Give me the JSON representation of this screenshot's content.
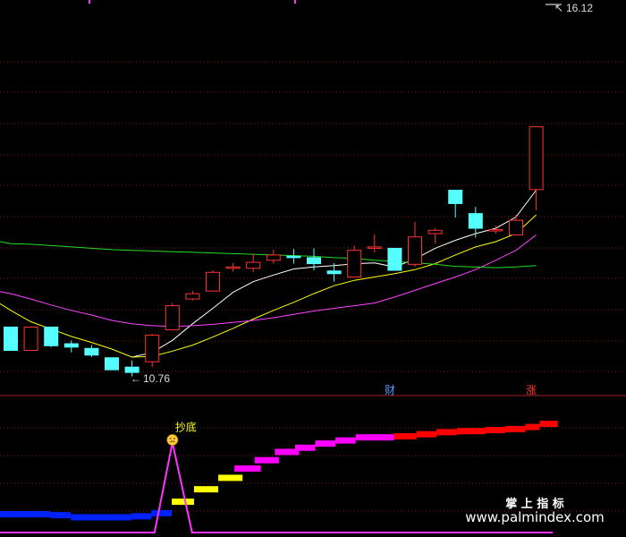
{
  "chart_data": [
    {
      "type": "candlestick",
      "panel": "price",
      "title": "",
      "ylim": [
        10.3,
        16.2
      ],
      "grid": true,
      "annotations": {
        "high_label": "16.12",
        "low_label": "10.76",
        "badge_cai": "财",
        "badge_zhang": "涨"
      },
      "candles": [
        {
          "o": 11.3,
          "c": 10.95,
          "h": 11.3,
          "l": 10.95
        },
        {
          "o": 10.95,
          "c": 11.3,
          "h": 11.3,
          "l": 10.95
        },
        {
          "o": 11.3,
          "c": 11.02,
          "h": 11.3,
          "l": 11.0
        },
        {
          "o": 11.05,
          "c": 11.0,
          "h": 11.1,
          "l": 10.92
        },
        {
          "o": 10.98,
          "c": 10.88,
          "h": 11.03,
          "l": 10.85
        },
        {
          "o": 10.84,
          "c": 10.66,
          "h": 10.84,
          "l": 10.66
        },
        {
          "o": 10.7,
          "c": 10.62,
          "h": 10.8,
          "l": 10.56
        },
        {
          "o": 10.78,
          "c": 11.18,
          "h": 11.2,
          "l": 10.7
        },
        {
          "o": 11.26,
          "c": 11.62,
          "h": 11.66,
          "l": 11.26
        },
        {
          "o": 11.72,
          "c": 11.8,
          "h": 11.84,
          "l": 11.7
        },
        {
          "o": 11.84,
          "c": 12.12,
          "h": 12.15,
          "l": 11.84
        },
        {
          "o": 12.18,
          "c": 12.2,
          "h": 12.26,
          "l": 12.13
        },
        {
          "o": 12.18,
          "c": 12.27,
          "h": 12.4,
          "l": 12.12
        },
        {
          "o": 12.3,
          "c": 12.38,
          "h": 12.46,
          "l": 12.25
        },
        {
          "o": 12.36,
          "c": 12.35,
          "h": 12.47,
          "l": 12.25
        },
        {
          "o": 12.34,
          "c": 12.25,
          "h": 12.48,
          "l": 12.15
        },
        {
          "o": 12.14,
          "c": 12.1,
          "h": 12.26,
          "l": 11.98
        },
        {
          "o": 12.05,
          "c": 12.45,
          "h": 12.52,
          "l": 12.05
        },
        {
          "o": 12.48,
          "c": 12.5,
          "h": 12.69,
          "l": 12.42
        },
        {
          "o": 12.48,
          "c": 12.15,
          "h": 12.48,
          "l": 12.15
        },
        {
          "o": 12.24,
          "c": 12.65,
          "h": 12.88,
          "l": 12.2
        },
        {
          "o": 12.7,
          "c": 12.75,
          "h": 12.78,
          "l": 12.55
        },
        {
          "o": 13.35,
          "c": 13.15,
          "h": 13.35,
          "l": 12.94
        },
        {
          "o": 13.0,
          "c": 12.78,
          "h": 13.1,
          "l": 12.64
        },
        {
          "o": 12.75,
          "c": 12.76,
          "h": 12.82,
          "l": 12.7
        },
        {
          "o": 12.68,
          "c": 12.9,
          "h": 12.98,
          "l": 12.68
        },
        {
          "o": 13.36,
          "c": 14.3,
          "h": 14.3,
          "l": 13.05
        }
      ],
      "series": [
        {
          "color": "#FFFFFF",
          "values": [
            null,
            null,
            null,
            null,
            null,
            null,
            10.85,
            10.92,
            11.1,
            11.35,
            11.58,
            11.82,
            11.98,
            12.08,
            12.17,
            12.2,
            12.22,
            12.25,
            12.26,
            12.2,
            12.32,
            12.48,
            12.6,
            12.7,
            12.78,
            12.95,
            13.35
          ]
        },
        {
          "color": "#FFFF00",
          "values": [
            11.55,
            11.38,
            11.27,
            11.16,
            11.07,
            10.97,
            10.85,
            10.86,
            10.94,
            11.03,
            11.15,
            11.28,
            11.42,
            11.55,
            11.67,
            11.8,
            11.92,
            12.0,
            12.05,
            12.1,
            12.16,
            12.25,
            12.38,
            12.5,
            12.58,
            12.7,
            12.98
          ]
        },
        {
          "color": "#FF44FF",
          "values": [
            11.8,
            11.72,
            11.63,
            11.55,
            11.48,
            11.4,
            11.35,
            11.32,
            11.31,
            11.32,
            11.34,
            11.37,
            11.4,
            11.44,
            11.49,
            11.54,
            11.58,
            11.62,
            11.66,
            11.75,
            11.85,
            11.95,
            12.05,
            12.16,
            12.3,
            12.45,
            12.68
          ]
        },
        {
          "color": "#22DD22",
          "values": [
            12.55,
            12.54,
            12.52,
            12.5,
            12.48,
            12.46,
            12.45,
            12.44,
            12.43,
            12.42,
            12.41,
            12.4,
            12.39,
            12.38,
            12.37,
            12.36,
            12.34,
            12.33,
            12.3,
            12.28,
            12.26,
            12.24,
            12.21,
            12.2,
            12.19,
            12.2,
            12.22
          ]
        }
      ]
    },
    {
      "type": "step",
      "panel": "indicator",
      "title": "",
      "ylim": [
        0,
        100
      ],
      "annotations": {
        "signal_label": "抄底",
        "signal_icon": "sad-face-icon"
      },
      "steps": [
        {
          "x0": 0.0,
          "x1": 2.5,
          "y": 3.0,
          "color": "#0022FF"
        },
        {
          "x0": 2.5,
          "x1": 3.5,
          "y": 2.0,
          "color": "#0022FF"
        },
        {
          "x0": 3.5,
          "x1": 6.5,
          "y": 0.0,
          "color": "#0022FF"
        },
        {
          "x0": 6.5,
          "x1": 7.5,
          "y": 1.0,
          "color": "#0022FF"
        },
        {
          "x0": 7.5,
          "x1": 8.5,
          "y": 4.0,
          "color": "#0022FF"
        },
        {
          "x0": 8.5,
          "x1": 9.6,
          "y": 15.0,
          "color": "#FFFF00"
        },
        {
          "x0": 9.6,
          "x1": 10.8,
          "y": 27.0,
          "color": "#FFFF00"
        },
        {
          "x0": 10.8,
          "x1": 12.0,
          "y": 38.0,
          "color": "#FFFF00"
        },
        {
          "x0": 11.6,
          "x1": 12.9,
          "y": 47.0,
          "color": "#FF00FF"
        },
        {
          "x0": 12.6,
          "x1": 13.8,
          "y": 55.0,
          "color": "#FF00FF"
        },
        {
          "x0": 13.6,
          "x1": 14.8,
          "y": 63.0,
          "color": "#FF00FF"
        },
        {
          "x0": 14.6,
          "x1": 15.6,
          "y": 67.0,
          "color": "#FF00FF"
        },
        {
          "x0": 15.6,
          "x1": 16.6,
          "y": 71.0,
          "color": "#FF00FF"
        },
        {
          "x0": 16.6,
          "x1": 17.6,
          "y": 74.0,
          "color": "#FF00FF"
        },
        {
          "x0": 17.6,
          "x1": 19.5,
          "y": 77.0,
          "color": "#FF00FF"
        },
        {
          "x0": 19.5,
          "x1": 20.6,
          "y": 78.0,
          "color": "#FF0000"
        },
        {
          "x0": 20.6,
          "x1": 21.6,
          "y": 80.0,
          "color": "#FF0000"
        },
        {
          "x0": 21.6,
          "x1": 22.6,
          "y": 82.0,
          "color": "#FF0000"
        },
        {
          "x0": 22.6,
          "x1": 24.0,
          "y": 83.0,
          "color": "#FF0000"
        },
        {
          "x0": 24.0,
          "x1": 25.0,
          "y": 84.0,
          "color": "#FF0000"
        },
        {
          "x0": 25.0,
          "x1": 26.0,
          "y": 85.0,
          "color": "#FF0000"
        },
        {
          "x0": 26.0,
          "x1": 26.7,
          "y": 87.0,
          "color": "#FF0000"
        },
        {
          "x0": 26.7,
          "x1": 27.6,
          "y": 90.0,
          "color": "#FF0000"
        }
      ],
      "signal_line": {
        "color": "#FF33FF",
        "baseline": -25,
        "peak_index": 8,
        "peak_value": 72
      }
    }
  ],
  "watermark": {
    "line1": "掌 上 指 标",
    "line2": "www.palmindex.com"
  },
  "colors": {
    "up": "#FF3333",
    "down": "#55FFFF",
    "grid": "#7A1A1A",
    "text": "#DDDDDD",
    "badge_cai": "#5599FF",
    "badge_zhang": "#FF3333"
  }
}
